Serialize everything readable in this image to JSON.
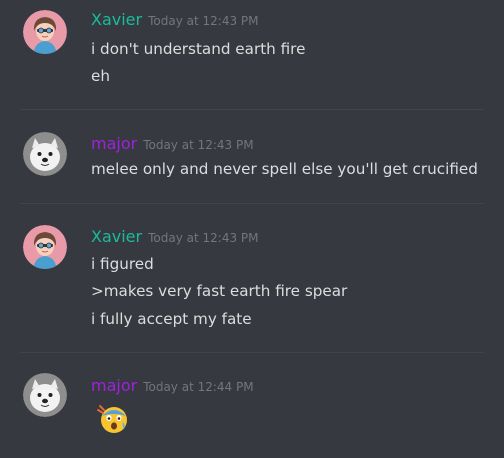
{
  "colors": {
    "background": "#36393f",
    "divider": "#40444b",
    "text": "#dcddde",
    "timestamp": "#72767d",
    "xavier_name": "#1abc9c",
    "major_name": "#a020e0"
  },
  "messages": [
    {
      "author": "Xavier",
      "timestamp": "Today at 12:43 PM",
      "avatar_icon": "anime-character-avatar",
      "lines": [
        "i don't understand earth fire",
        "eh"
      ]
    },
    {
      "author": "major",
      "timestamp": "Today at 12:43 PM",
      "avatar_icon": "samoyed-dog-avatar",
      "lines": [
        "melee only and never spell else you'll get crucified"
      ]
    },
    {
      "author": "Xavier",
      "timestamp": "Today at 12:43 PM",
      "avatar_icon": "anime-character-avatar",
      "lines": [
        "i figured",
        ">makes very fast earth fire spear",
        "i fully accept my fate"
      ]
    },
    {
      "author": "major",
      "timestamp": "Today at 12:44 PM",
      "avatar_icon": "samoyed-dog-avatar",
      "emoji": "face-screaming-in-fear-emoji"
    }
  ]
}
